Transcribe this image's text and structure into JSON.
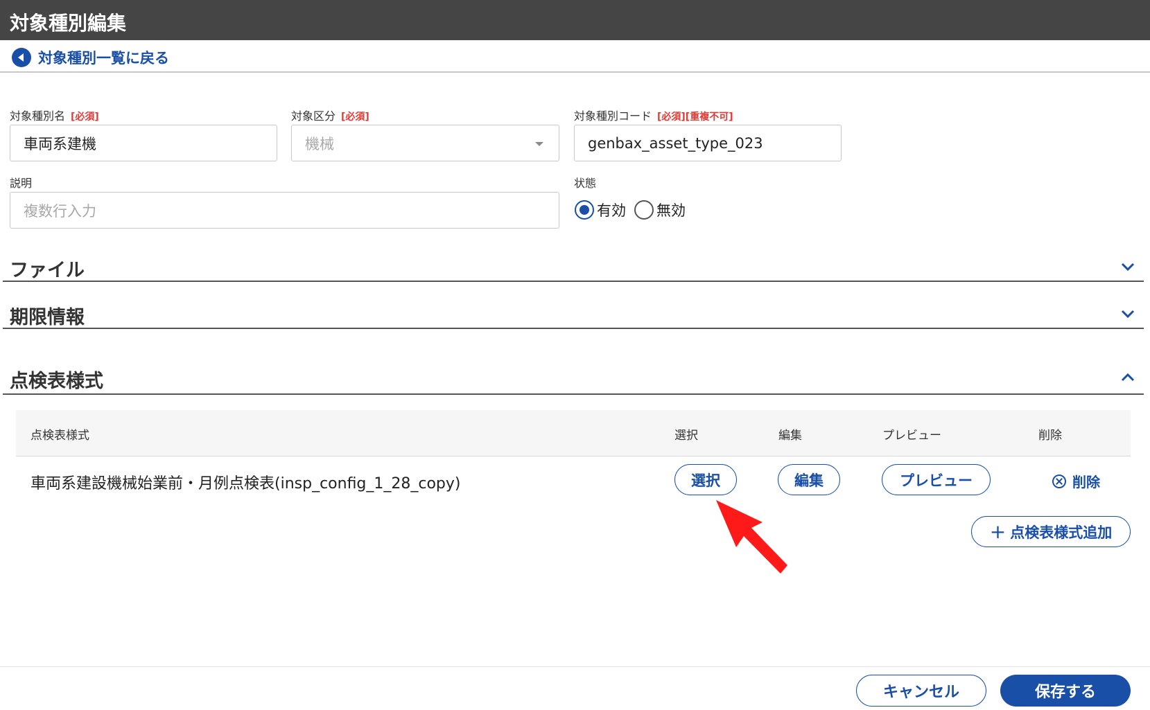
{
  "header": {
    "title": "対象種別編集"
  },
  "back": {
    "label": "対象種別一覧に戻る"
  },
  "form": {
    "name": {
      "label": "対象種別名",
      "required": "[必須]",
      "value": "車両系建機"
    },
    "category": {
      "label": "対象区分",
      "required": "[必須]",
      "value": "機械"
    },
    "code": {
      "label": "対象種別コード",
      "required": "[必須][重複不可]",
      "value": "genbax_asset_type_023"
    },
    "description": {
      "label": "説明",
      "placeholder": "複数行入力"
    },
    "status": {
      "label": "状態",
      "options": [
        "有効",
        "無効"
      ],
      "selected": "有効"
    }
  },
  "sections": {
    "files": {
      "title": "ファイル"
    },
    "expiry": {
      "title": "期限情報"
    },
    "inspection": {
      "title": "点検表様式"
    }
  },
  "inspection_table": {
    "headers": [
      "点検表様式",
      "選択",
      "編集",
      "プレビュー",
      "削除"
    ],
    "rows": [
      {
        "name": "車両系建設機械始業前・月例点検表(insp_config_1_28_copy)",
        "select_label": "選択",
        "edit_label": "編集",
        "preview_label": "プレビュー",
        "delete_label": "削除"
      }
    ],
    "add_label": "点検表様式追加"
  },
  "footer": {
    "cancel_label": "キャンセル",
    "save_label": "保存する"
  },
  "colors": {
    "accent": "#1a4fa8",
    "required": "#e53935",
    "header_bg": "#454545",
    "arrow": "#ff1a1a"
  }
}
